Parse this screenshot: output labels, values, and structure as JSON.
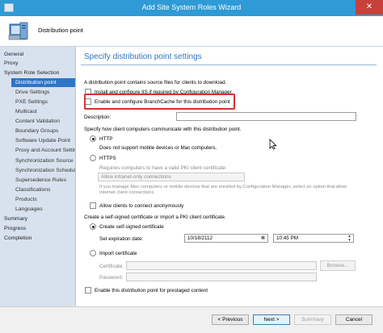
{
  "window": {
    "title": "Add Site System Roles Wizard",
    "close_glyph": "✕"
  },
  "banner": {
    "title": "Distribution point",
    "icon": "server-role-icon"
  },
  "nav": {
    "items": [
      {
        "label": "General"
      },
      {
        "label": "Proxy"
      },
      {
        "label": "System Role Selection"
      },
      {
        "label": "Distribution point"
      },
      {
        "label": "Drive Settings"
      },
      {
        "label": "PXE Settings"
      },
      {
        "label": "Multicast"
      },
      {
        "label": "Content Validation"
      },
      {
        "label": "Boundary Groups"
      },
      {
        "label": "Software Update Point"
      },
      {
        "label": "Proxy and Account Settin"
      },
      {
        "label": "Synchronization Source"
      },
      {
        "label": "Synchronization Schedule"
      },
      {
        "label": "Supersedence Rules"
      },
      {
        "label": "Classifications"
      },
      {
        "label": "Products"
      },
      {
        "label": "Languages"
      },
      {
        "label": "Summary"
      },
      {
        "label": "Progress"
      },
      {
        "label": "Completion"
      }
    ],
    "selected": "Distribution point"
  },
  "main": {
    "heading": "Specify distribution point settings",
    "intro": "A distribution point contains source files for clients to download.",
    "install_iis": {
      "label": "Install and configure IIS if required by Configuration Manager",
      "checked": false
    },
    "branchcache": {
      "label": "Enable and configure BranchCache for this distribution point",
      "checked": false
    },
    "description": {
      "label": "Description:",
      "value": ""
    },
    "comm_label": "Specify how client computers communicate with this distribution point.",
    "http": {
      "label": "HTTP",
      "selected": true,
      "note": "Does not support mobile devices or Mac computers."
    },
    "https": {
      "label": "HTTPS",
      "selected": false,
      "cert_note": "Requires computers to have a valid PKI client certificate:",
      "select_value": "Allow intranet-only connections",
      "mac_note_1": "If you manage Mac computers or mobile devices that are enrolled by Configuration Manager, select an option that allow",
      "mac_note_2": "Internet client connections."
    },
    "anonymous": {
      "label": "Allow clients to connect anonymously",
      "checked": false
    },
    "cert_section": "Create a self-signed certificate or import a PKI client certificate.",
    "self_signed": {
      "label": "Create self-signed certificate",
      "selected": true
    },
    "expiration": {
      "label": "Set expiration date:",
      "date": "10/18/2112",
      "time": "10:45 PM"
    },
    "import_cert": {
      "label": "Import certificate",
      "selected": false
    },
    "certificate": {
      "label": "Certificate:",
      "value": "",
      "browse": "Browse..."
    },
    "password": {
      "label": "Password:",
      "value": ""
    },
    "prestaged": {
      "label": "Enable this distribution point for prestaged content",
      "checked": false
    }
  },
  "footer": {
    "previous": "< Previous",
    "next": "Next >",
    "summary": "Summary",
    "cancel": "Cancel"
  },
  "colors": {
    "accent": "#2e75c8",
    "titlebar": "#2e9ad6",
    "highlight": "#d6322e",
    "nav_bg": "#d8e2ee"
  }
}
